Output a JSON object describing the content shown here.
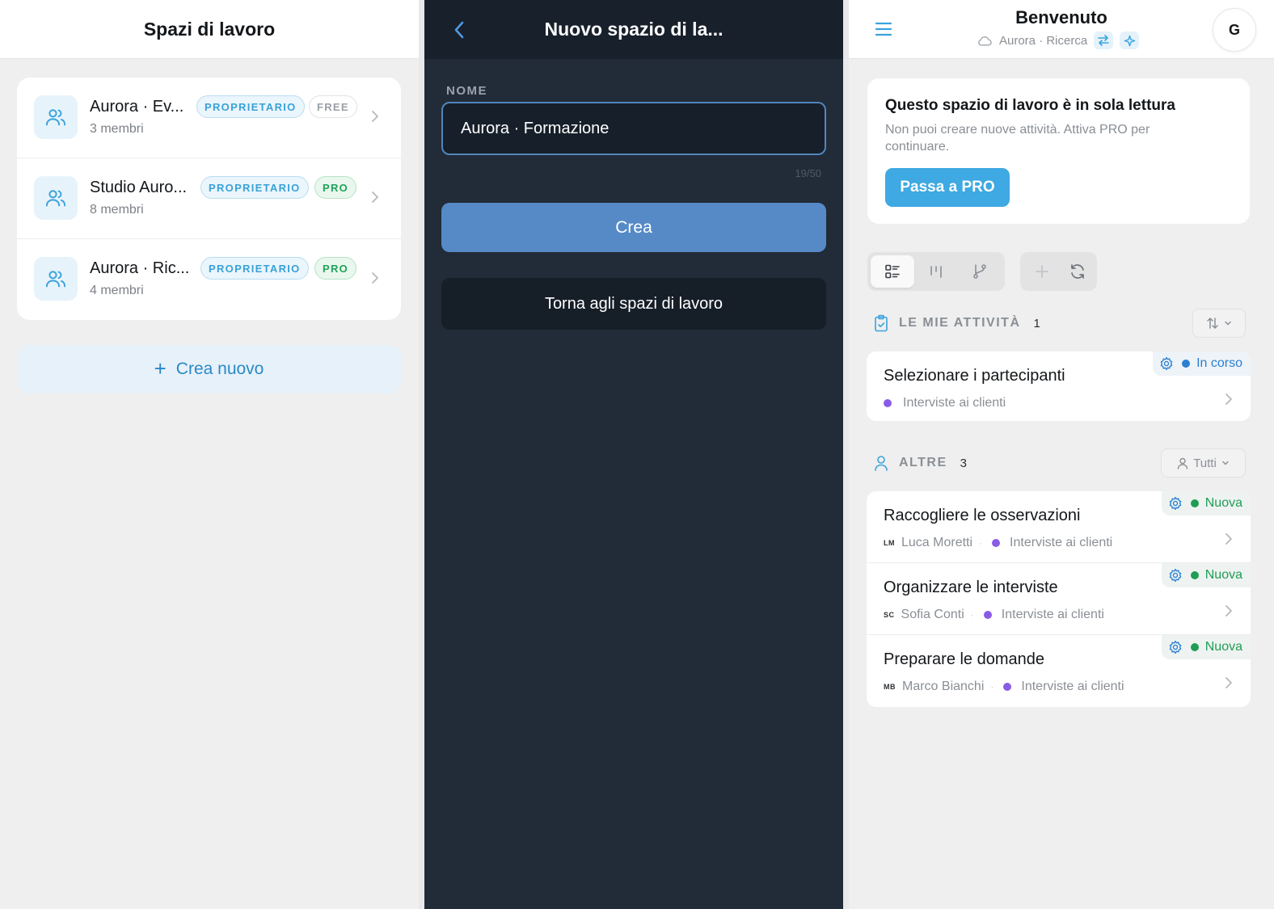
{
  "workspaces_panel": {
    "title": "Spazi di lavoro",
    "items": [
      {
        "name": "Aurora · Ev...",
        "members": "3 membri",
        "role": "PROPRIETARIO",
        "plan": "FREE"
      },
      {
        "name": "Studio Auro...",
        "members": "8 membri",
        "role": "PROPRIETARIO",
        "plan": "PRO"
      },
      {
        "name": "Aurora · Ric...",
        "members": "4 membri",
        "role": "PROPRIETARIO",
        "plan": "PRO"
      }
    ],
    "create_new": "Crea nuovo"
  },
  "new_workspace_panel": {
    "title": "Nuovo spazio di la...",
    "field_label": "NOME",
    "name_value": "Aurora · Formazione",
    "counter": "19/50",
    "create_label": "Crea",
    "back_label": "Torna agli spazi di lavoro"
  },
  "dashboard_panel": {
    "title": "Benvenuto",
    "subtitle": "Aurora · Ricerca",
    "avatar_initial": "G",
    "readonly": {
      "title": "Questo spazio di lavoro è in sola lettura",
      "text": "Non puoi creare nuove attività. Attiva PRO per continuare.",
      "button": "Passa a PRO"
    },
    "my_tasks": {
      "title": "LE MIE ATTIVITÀ",
      "count": "1",
      "items": [
        {
          "title": "Selezionare i partecipanti",
          "project": "Interviste ai clienti",
          "status": "In corso"
        }
      ]
    },
    "others": {
      "title": "ALTRE",
      "count": "3",
      "filter": "Tutti",
      "items": [
        {
          "title": "Raccogliere le osservazioni",
          "initials": "LM",
          "assignee": "Luca Moretti",
          "project": "Interviste ai clienti",
          "status": "Nuova"
        },
        {
          "title": "Organizzare le interviste",
          "initials": "SC",
          "assignee": "Sofia Conti",
          "project": "Interviste ai clienti",
          "status": "Nuova"
        },
        {
          "title": "Preparare le domande",
          "initials": "MB",
          "assignee": "Marco Bianchi",
          "project": "Interviste ai clienti",
          "status": "Nuova"
        }
      ]
    }
  },
  "colors": {
    "accent": "#3ea9e2",
    "dark_panel": "#222b38",
    "create_button": "#558ac7",
    "pro_green": "#21a35a",
    "status_blue": "#2a7fd1",
    "status_green": "#1f9d55",
    "project_dot": "#8a5ce6"
  },
  "icons": [
    "users-icon",
    "chevron-right-icon",
    "plus-icon",
    "back-arrow-icon",
    "menu-icon",
    "cloud-icon",
    "swap-icon",
    "sparkle-icon",
    "list-view-icon",
    "board-view-icon",
    "branch-view-icon",
    "refresh-icon",
    "clipboard-icon",
    "sort-icon",
    "chevron-down-icon",
    "user-icon",
    "gear-icon"
  ]
}
